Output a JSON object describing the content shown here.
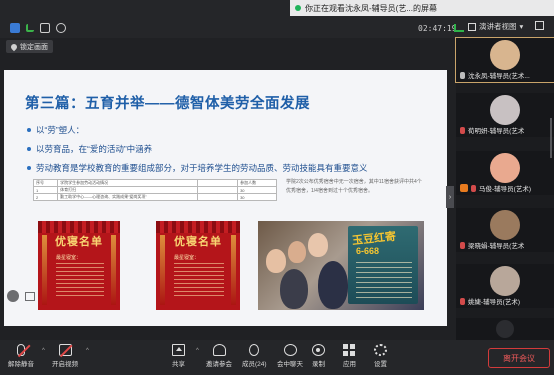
{
  "top": {
    "share_banner": "你正在观看沈永凤-辅导员(艺...的屏幕",
    "clock": "02:47:19",
    "view_label": "演讲者视图",
    "lock_label": "锁定画面"
  },
  "slide": {
    "title": "第三篇：五育并举——德智体美劳全面发展",
    "bullets": [
      "以“劳”塑人：",
      "以劳育品，在“爱的活动”中涵养",
      "劳动教育是学校教育的重要组成部分，对于培养学生的劳动品质、劳动技能具有重要意义"
    ],
    "table": [
      [
        "序号",
        "学院学生参加劳动活动情况",
        "",
        "参加人数"
      ],
      [
        "1",
        "体育打扫",
        "",
        "30"
      ],
      [
        "2",
        "勤工助学中心——心理咨询、实践成果“爱岗奖项”",
        "",
        "30"
      ]
    ],
    "note": "学院2次公布优秀宿舍中无一次宿舍，其中11宿舍获评中共4个优秀宿舍，1/4宿舍到过十个优秀宿舍。",
    "poster_title": "优寝名单",
    "poster_sub": "最星寝室：",
    "board_title": "玉豆红寄",
    "board_sub": "6-668"
  },
  "participants": [
    {
      "name": "沈永凤-辅导员(艺术...",
      "muted": false,
      "hand": false,
      "highlight": true,
      "color": "#d8b58f"
    },
    {
      "name": "荀明妍-辅导员(艺术",
      "muted": true,
      "hand": false,
      "highlight": false,
      "color": "#c8c1c2"
    },
    {
      "name": "马俊-辅导员(艺术)",
      "muted": true,
      "hand": true,
      "highlight": false,
      "color": "#e9a98f"
    },
    {
      "name": "梁晓娟-辅导员(艺术",
      "muted": true,
      "hand": false,
      "highlight": false,
      "color": "#9a7a5e"
    },
    {
      "name": "姚婕-辅导员(艺术)",
      "muted": true,
      "hand": false,
      "highlight": false,
      "color": "#b8a79a"
    },
    {
      "name": "",
      "muted": false,
      "hand": false,
      "highlight": false,
      "color": "#2b2c30"
    }
  ],
  "toolbar": {
    "unmute": "解除静音",
    "video": "开启视频",
    "share": "共享",
    "invite": "邀请参会",
    "members": "成员(24)",
    "chat": "会中聊天",
    "record": "录制",
    "apps": "应用",
    "settings": "设置",
    "leave": "离开会议"
  }
}
